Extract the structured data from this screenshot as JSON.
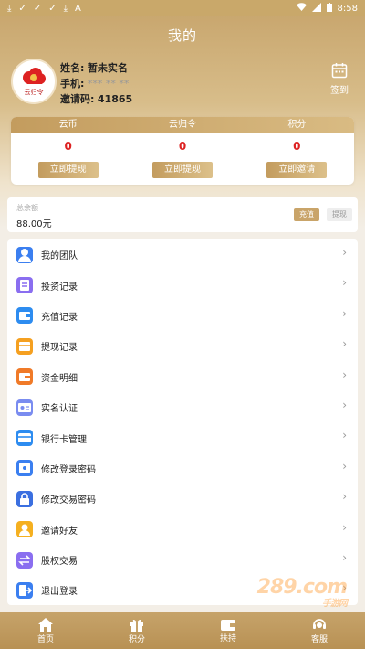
{
  "statusbar": {
    "time": "8:58"
  },
  "header": {
    "title": "我的"
  },
  "profile": {
    "avatar_text": "云归令",
    "name_label": "姓名:",
    "name_value": "暂未实名",
    "phone_label": "手机:",
    "phone_value": "*** ** **",
    "invite_label": "邀请码:",
    "invite_value": "41865",
    "signin_label": "签到"
  },
  "assets": [
    {
      "title": "云币",
      "value": "0",
      "button": "立即提现"
    },
    {
      "title": "云归令",
      "value": "0",
      "button": "立即提现"
    },
    {
      "title": "积分",
      "value": "0",
      "button": "立即邀请"
    }
  ],
  "balance": {
    "label": "总余额",
    "value": "88.00元",
    "recharge": "充值",
    "withdraw": "提现"
  },
  "menu": [
    {
      "label": "我的团队",
      "icon": "team-icon",
      "color": "#3b7ff0"
    },
    {
      "label": "投资记录",
      "icon": "invest-record-icon",
      "color": "#8a6ef0"
    },
    {
      "label": "充值记录",
      "icon": "wallet-icon",
      "color": "#2d8cf0"
    },
    {
      "label": "提现记录",
      "icon": "withdraw-record-icon",
      "color": "#f5a020"
    },
    {
      "label": "资金明细",
      "icon": "funds-detail-icon",
      "color": "#f07a28"
    },
    {
      "label": "实名认证",
      "icon": "id-card-icon",
      "color": "#7a8cf0"
    },
    {
      "label": "银行卡管理",
      "icon": "bank-card-icon",
      "color": "#2d8cf0"
    },
    {
      "label": "修改登录密码",
      "icon": "login-password-icon",
      "color": "#3b7ff0"
    },
    {
      "label": "修改交易密码",
      "icon": "lock-icon",
      "color": "#3b6fe0"
    },
    {
      "label": "邀请好友",
      "icon": "invite-friends-icon",
      "color": "#f5b020"
    },
    {
      "label": "股权交易",
      "icon": "exchange-icon",
      "color": "#8a6ef0"
    },
    {
      "label": "退出登录",
      "icon": "logout-icon",
      "color": "#3b7ff0"
    }
  ],
  "watermark": {
    "brand": "289.com",
    "sub": "手游网"
  },
  "tabs": [
    {
      "label": "首页",
      "icon": "home-icon"
    },
    {
      "label": "积分",
      "icon": "gift-icon"
    },
    {
      "label": "扶持",
      "icon": "support-wallet-icon"
    },
    {
      "label": "客服",
      "icon": "customer-service-icon"
    }
  ]
}
